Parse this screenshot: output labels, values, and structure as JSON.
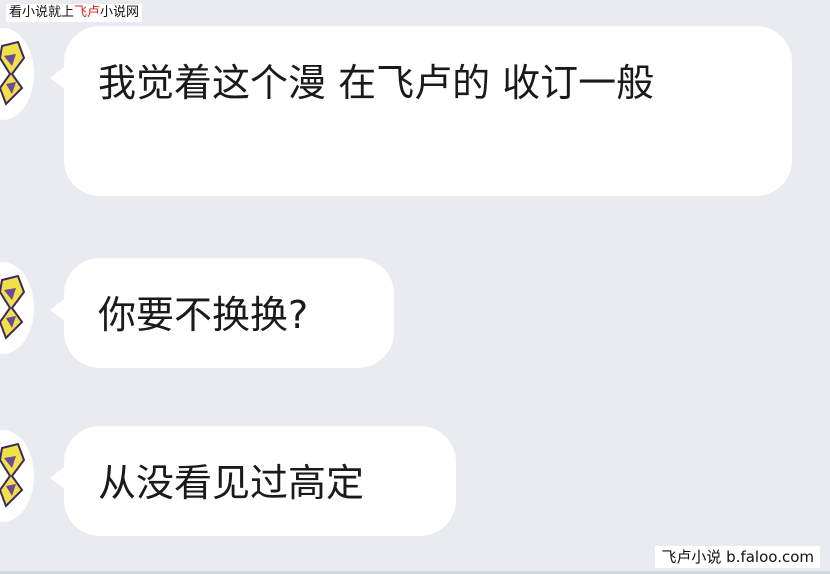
{
  "watermark_top": {
    "part1": "看小说就上",
    "accent": "飞卢",
    "part2": "小说网",
    "accent_color": "#e0201b"
  },
  "messages": [
    {
      "text": "我觉着这个漫 在飞卢的 收订一般"
    },
    {
      "text": "你要不换换?"
    },
    {
      "text": "从没看见过高定"
    }
  ],
  "watermark_bottom": "飞卢小说  b.faloo.com",
  "colors": {
    "background": "#e9ebf1",
    "bubble": "#ffffff"
  }
}
